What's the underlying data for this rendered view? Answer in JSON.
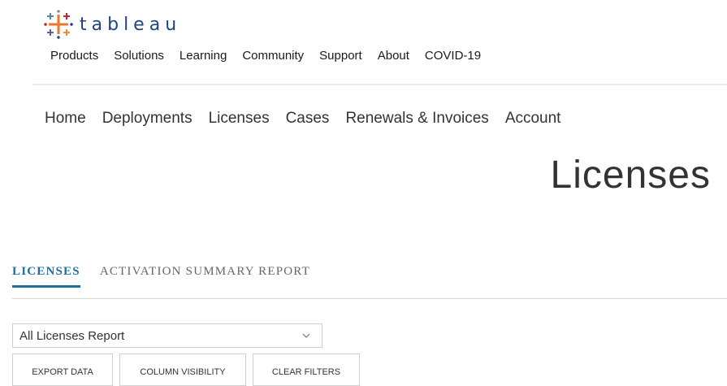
{
  "brand": {
    "name": "tableau"
  },
  "top_nav": [
    "Products",
    "Solutions",
    "Learning",
    "Community",
    "Support",
    "About",
    "COVID-19"
  ],
  "sub_nav": [
    "Home",
    "Deployments",
    "Licenses",
    "Cases",
    "Renewals & Invoices",
    "Account"
  ],
  "page_title": "Licenses",
  "tabs": {
    "licenses": "LICENSES",
    "activation": "ACTIVATION SUMMARY REPORT"
  },
  "report_select": {
    "value": "All Licenses Report"
  },
  "buttons": {
    "export": "EXPORT DATA",
    "column_visibility": "COLUMN VISIBILITY",
    "clear_filters": "CLEAR FILTERS"
  },
  "colors": {
    "accent": "#1f6ea0",
    "logo_blue": "#1f457e"
  },
  "icons": {
    "logo": "tableau-plus-cluster-icon",
    "select": "chevron-down-icon"
  }
}
